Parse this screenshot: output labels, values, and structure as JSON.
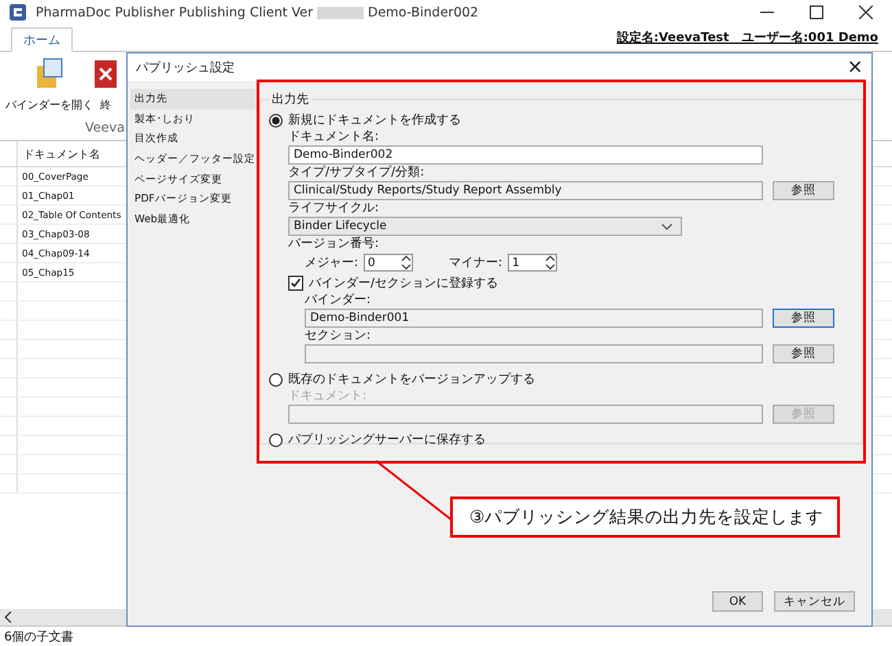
{
  "window": {
    "title": "PharmaDoc Publisher Publishing Client Ver",
    "title_suffix": "Demo-Binder002"
  },
  "tabs": [
    {
      "label": "ホーム",
      "selected": true
    }
  ],
  "header_info": "設定名:VeevaTest　ユーザー名:001 Demo",
  "ribbon": {
    "buttons": [
      {
        "label": "バインダーを開く",
        "kind": "binder"
      },
      {
        "label": "終",
        "kind": "close"
      }
    ],
    "group_label": "Veeva"
  },
  "table": {
    "columns": [
      "ドキュメント名"
    ],
    "rows": [
      {
        "name": "00_CoverPage"
      },
      {
        "name": "01_Chap01"
      },
      {
        "name": "02_Table Of Contents"
      },
      {
        "name": "03_Chap03-08"
      },
      {
        "name": "04_Chap09-14"
      },
      {
        "name": "05_Chap15"
      }
    ]
  },
  "status_bar": "6個の子文書",
  "dialog": {
    "title": "パブリッシュ設定",
    "close": "×",
    "nav": [
      {
        "label": "出力先",
        "selected": true
      },
      {
        "label": "製本･しおり",
        "selected": false
      },
      {
        "label": "目次作成",
        "selected": false
      },
      {
        "label": "ヘッダー／フッター設定",
        "selected": false
      },
      {
        "label": "ページサイズ変更",
        "selected": false
      },
      {
        "label": "PDFバージョン変更",
        "selected": false
      },
      {
        "label": "Web最適化",
        "selected": false
      }
    ],
    "group_title": "出力先",
    "new_document": {
      "label": "新規にドキュメントを作成する",
      "selected": true,
      "name_label": "ドキュメント名:",
      "name_value": "Demo-Binder002",
      "type_label": "タイプ/サブタイプ/分類:",
      "type_value": "Clinical/Study Reports/Study Report Assembly",
      "type_browse": "参照",
      "lifecycle_label": "ライフサイクル:",
      "lifecycle_value": "Binder Lifecycle",
      "version_label": "バージョン番号:",
      "major_label": "メジャー:",
      "major_value": "0",
      "minor_label": "マイナー:",
      "minor_value": "1",
      "register": {
        "label": "バインダー/セクションに登録する",
        "checked": true,
        "binder_label": "バインダー:",
        "binder_value": "Demo-Binder001",
        "binder_browse": "参照",
        "section_label": "セクション:",
        "section_browse": "参照"
      }
    },
    "version_up": {
      "label": "既存のドキュメントをバージョンアップする",
      "selected": false,
      "disabled": true,
      "document_label": "ドキュメント:",
      "browse": "参照"
    },
    "server": {
      "label": "パブリッシングサーバーに保存する",
      "selected": false
    },
    "buttons": [
      "OK",
      "キャンセル"
    ]
  },
  "callout": "③パブリッシング結果の出力先を設定します"
}
